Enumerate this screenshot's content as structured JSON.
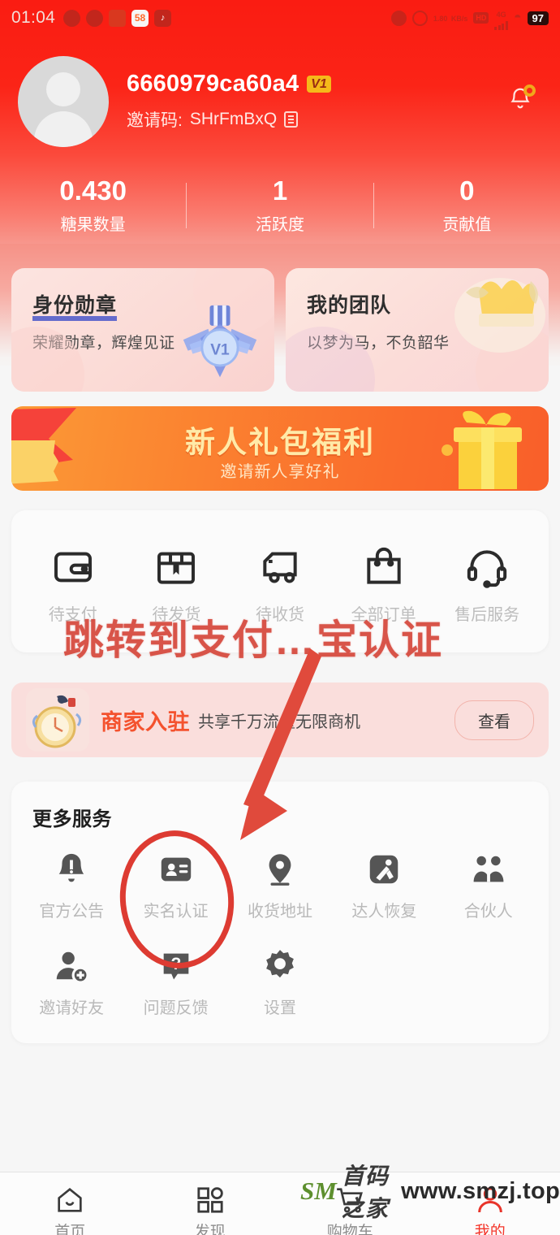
{
  "status_bar": {
    "time": "01:04",
    "left_icons": [
      "wechat-icon",
      "opera-icon",
      "alipay-icon",
      "58-icon",
      "douyin-icon"
    ],
    "badge_58": "58",
    "douyin_glyph": "♪",
    "net_speed_value": "1.80",
    "net_speed_unit": "KB/s",
    "hd_label": "HD",
    "network_type": "4G",
    "battery": "97",
    "right_icons": [
      "alarm-icon",
      "speedometer-icon",
      "hd-icon",
      "signal-icon",
      "wifi-icon",
      "battery-icon"
    ]
  },
  "profile": {
    "username": "6660979ca60a4",
    "level_badge": "V1",
    "invite_label": "邀请码:",
    "invite_code": "SHrFmBxQ",
    "copy_icon": "copy-icon",
    "bell_icon": "bell-icon",
    "avatar_icon": "avatar-placeholder"
  },
  "stats": [
    {
      "value": "0.430",
      "label": "糖果数量"
    },
    {
      "value": "1",
      "label": "活跃度"
    },
    {
      "value": "0",
      "label": "贡献值"
    }
  ],
  "feature_cards": [
    {
      "title": "身份勋章",
      "subtitle": "荣耀勋章，辉煌见证",
      "icon": "medal-icon",
      "badge_text": "V1"
    },
    {
      "title": "我的团队",
      "subtitle": "以梦为马，不负韶华",
      "icon": "crown-icon"
    }
  ],
  "promo_banner": {
    "title": "新人礼包福利",
    "subtitle": "邀请新人享好礼",
    "icons": [
      "ribbon-icon",
      "gift-box-icon"
    ]
  },
  "order_section": {
    "items": [
      {
        "label": "待支付",
        "icon": "wallet-icon"
      },
      {
        "label": "待发货",
        "icon": "package-icon"
      },
      {
        "label": "待收货",
        "icon": "truck-icon"
      },
      {
        "label": "全部订单",
        "icon": "shopping-bag-icon"
      },
      {
        "label": "售后服务",
        "icon": "headset-icon"
      }
    ]
  },
  "merchant_banner": {
    "title": "商家入驻",
    "subtitle": "共享千万流量无限商机",
    "button": "查看",
    "icon": "merchant-clock-icon"
  },
  "more_services": {
    "title": "更多服务",
    "items": [
      {
        "label": "官方公告",
        "icon": "bell-alert-icon"
      },
      {
        "label": "实名认证",
        "icon": "id-card-icon"
      },
      {
        "label": "收货地址",
        "icon": "location-pin-icon"
      },
      {
        "label": "达人恢复",
        "icon": "expert-icon"
      },
      {
        "label": "合伙人",
        "icon": "partners-icon"
      },
      {
        "label": "邀请好友",
        "icon": "add-user-icon"
      },
      {
        "label": "问题反馈",
        "icon": "question-bubble-icon"
      },
      {
        "label": "设置",
        "icon": "gear-icon"
      }
    ]
  },
  "bottom_nav": [
    {
      "label": "首页",
      "icon": "home-icon",
      "active": false
    },
    {
      "label": "发现",
      "icon": "grid-icon",
      "active": false
    },
    {
      "label": "购物车",
      "icon": "cart-icon",
      "active": false
    },
    {
      "label": "我的",
      "icon": "user-icon",
      "active": true
    }
  ],
  "annotations": {
    "red_text": "跳转到支付…宝认证",
    "arrow_icon": "red-arrow-icon",
    "circle_icon": "red-circle-highlight",
    "target_label": "实名认证"
  },
  "watermark": {
    "logo": "SM",
    "name": "首码之家",
    "url": "www.smzj.top"
  },
  "colors": {
    "brand_red": "#fb2417",
    "accent_orange": "#f95f2a",
    "badge_gold": "#f5b91a",
    "annotation_red": "#d6483c",
    "card_pink": "#fadedc"
  }
}
